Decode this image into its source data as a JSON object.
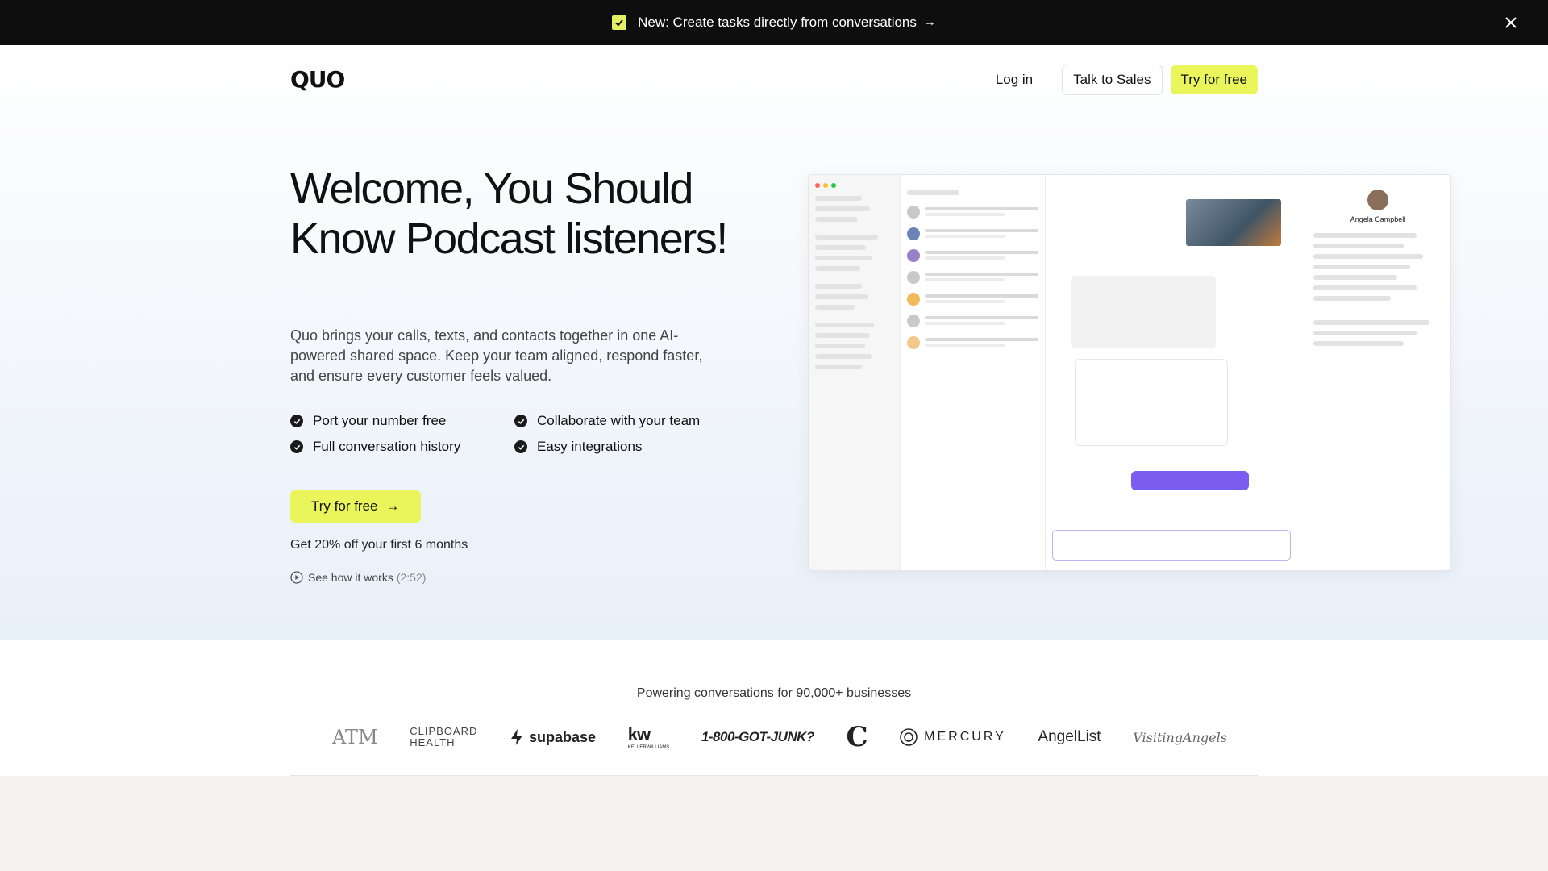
{
  "announcement": {
    "text": "New: Create tasks directly from conversations",
    "arrow": "→"
  },
  "header": {
    "logo": "QUO",
    "login_label": "Log in",
    "sales_label": "Talk to Sales",
    "try_label": "Try for free"
  },
  "hero": {
    "headline": "Welcome, You Should Know Podcast listeners!",
    "subtext": "Quo brings your calls, texts, and contacts together in one AI-powered shared space. Keep your team aligned, respond faster, and ensure every customer feels valued.",
    "features": [
      "Port your number free",
      "Collaborate with your team",
      "Full conversation history",
      "Easy integrations"
    ],
    "cta_label": "Try for free",
    "cta_arrow": "→",
    "discount": "Get 20% off your first 6 months",
    "watch_label": "See how it works",
    "watch_duration": "(2:52)"
  },
  "screenshot": {
    "profile_name": "Angela Campbell"
  },
  "logos": {
    "title": "Powering conversations for 90,000+ businesses",
    "items": {
      "tam": "ATM",
      "clipboard_line1": "CLIPBOARD",
      "clipboard_line2": "HEALTH",
      "supabase": "supabase",
      "kw": "kw",
      "kw_sub": "KELLERWILLIAMS",
      "junk": "1-800-GOT-JUNK?",
      "c": "C",
      "mercury": "MERCURY",
      "angellist": "AngelList",
      "visiting": "VisitingAngels"
    }
  },
  "colors": {
    "accent": "#e9f55a",
    "dark": "#0e0e0e"
  }
}
